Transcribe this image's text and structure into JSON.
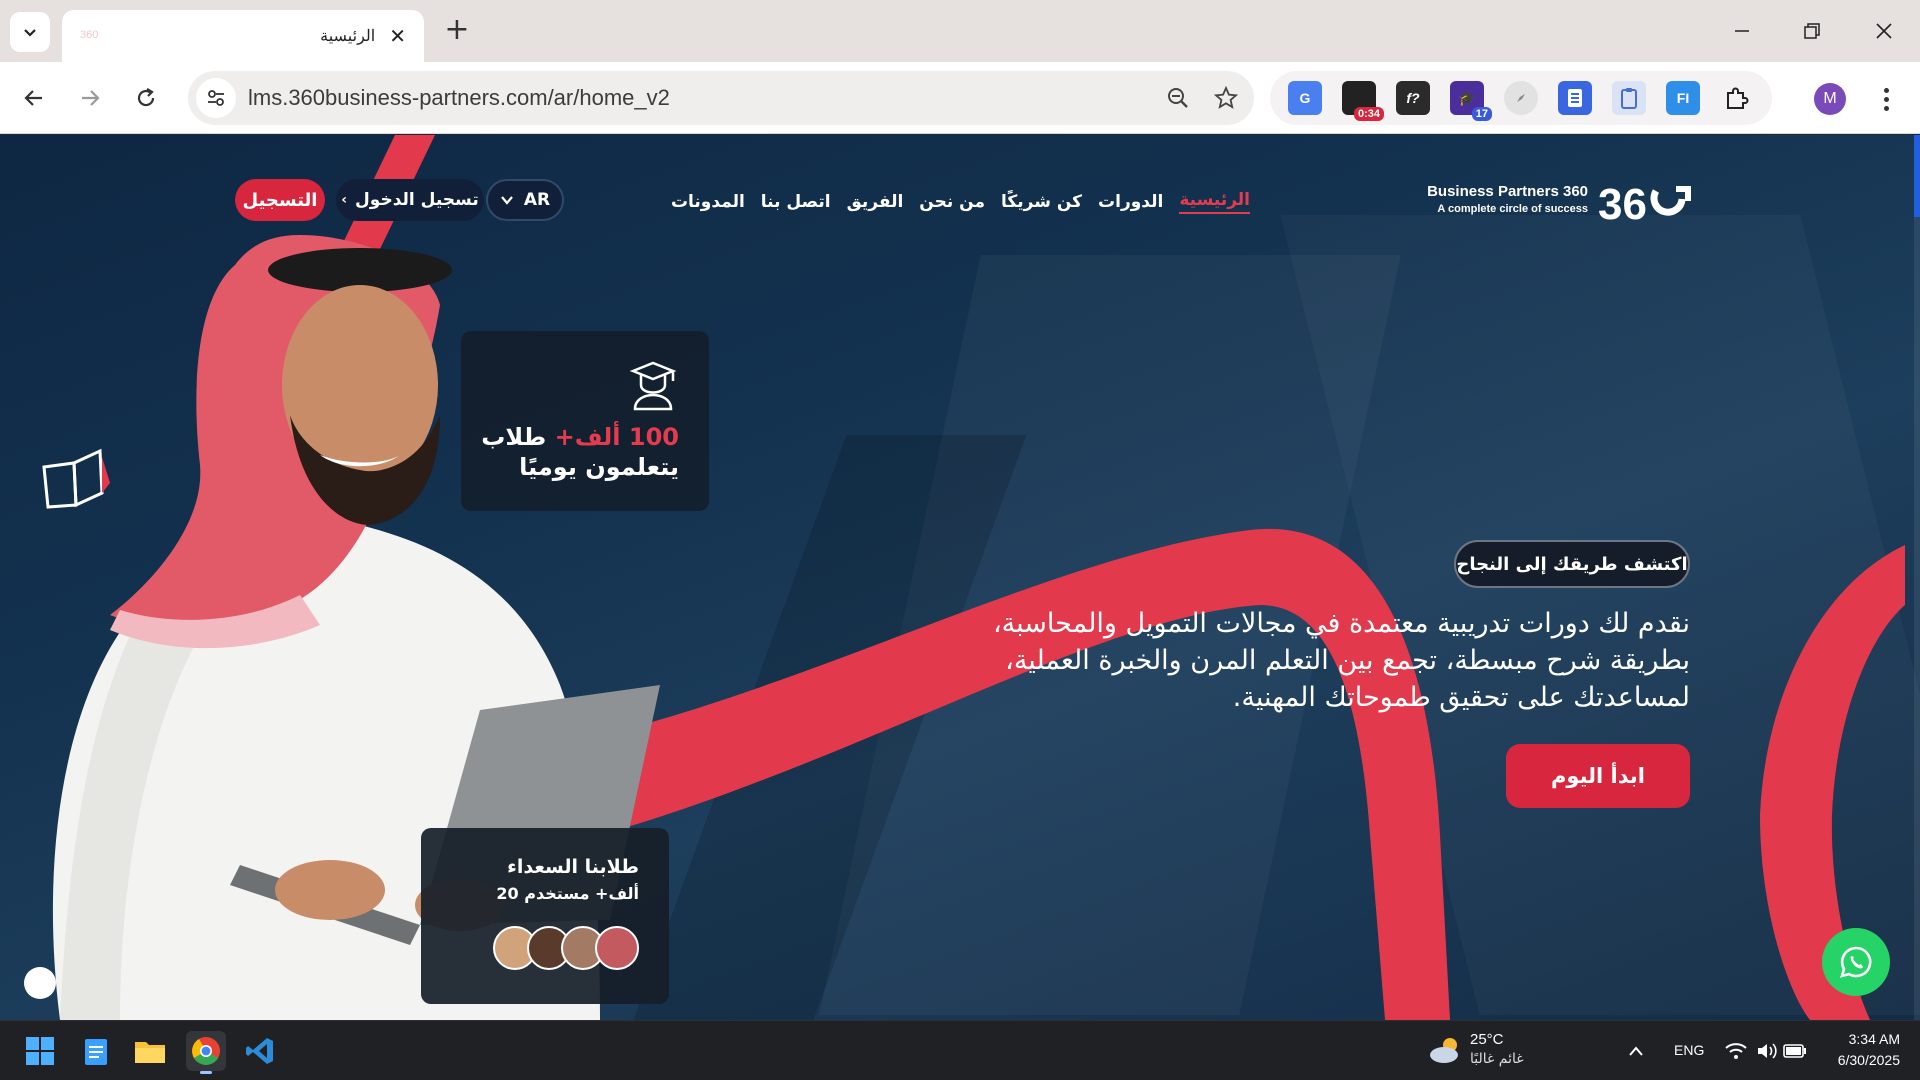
{
  "browser": {
    "tab_title": "الرئيسية",
    "tab_favicon_text": "360",
    "url": "lms.360business-partners.com/ar/home_v2",
    "extensions": [
      {
        "name": "google-translate-icon",
        "color": "#4a7ff0",
        "text": "G"
      },
      {
        "name": "timer-extension-icon",
        "color": "#222222",
        "badge": "0:34"
      },
      {
        "name": "font-identifier-icon",
        "color": "#2b2b2b",
        "text": "f?"
      },
      {
        "name": "graduation-extension-icon",
        "color": "#4a2f9c",
        "badge": "17"
      },
      {
        "name": "compass-extension-icon",
        "color": "#c9c9c9",
        "text": ""
      },
      {
        "name": "reader-extension-icon",
        "color": "#3a67e0",
        "text": ""
      },
      {
        "name": "clipboard-extension-icon",
        "color": "#5a7fd8",
        "text": ""
      },
      {
        "name": "fi-extension-icon",
        "color": "#2f8ee8",
        "text": "FI"
      }
    ],
    "profile_initial": "M"
  },
  "site": {
    "logo_line1": "Business Partners 360",
    "logo_line2": "A complete circle of success",
    "nav": [
      "الرئيسية",
      "الدورات",
      "كن شريكًا",
      "من نحن",
      "الفريق",
      "اتصل بنا",
      "المدونات"
    ],
    "active_nav": "الرئيسية",
    "lang": "AR",
    "login": "تسجيل الدخول",
    "register": "التسجيل",
    "stat_number": "100 ألف+",
    "stat_suffix": "طلاب",
    "stat_line2": "يتعلمون يوميًا",
    "students_title": "طلابنا السعداء",
    "students_count": "20 ألف+ مستخدم",
    "discover": "اكتشف طريقك إلى النجاح",
    "hero_line1": "نقدم لك دورات تدريبية معتمدة في مجالات التمويل والمحاسبة،",
    "hero_line2": "بطريقة شرح مبسطة، تجمع بين التعلم المرن والخبرة العملية،",
    "hero_line3": "لمساعدتك على تحقيق طموحاتك المهنية.",
    "cta": "ابدأ اليوم"
  },
  "taskbar": {
    "temperature": "25°C",
    "weather_condition": "غائم غالبًا",
    "language": "ENG",
    "time": "3:34 AM",
    "date": "6/30/2025"
  },
  "colors": {
    "accent": "#d7263d",
    "whatsapp": "#25d366"
  }
}
